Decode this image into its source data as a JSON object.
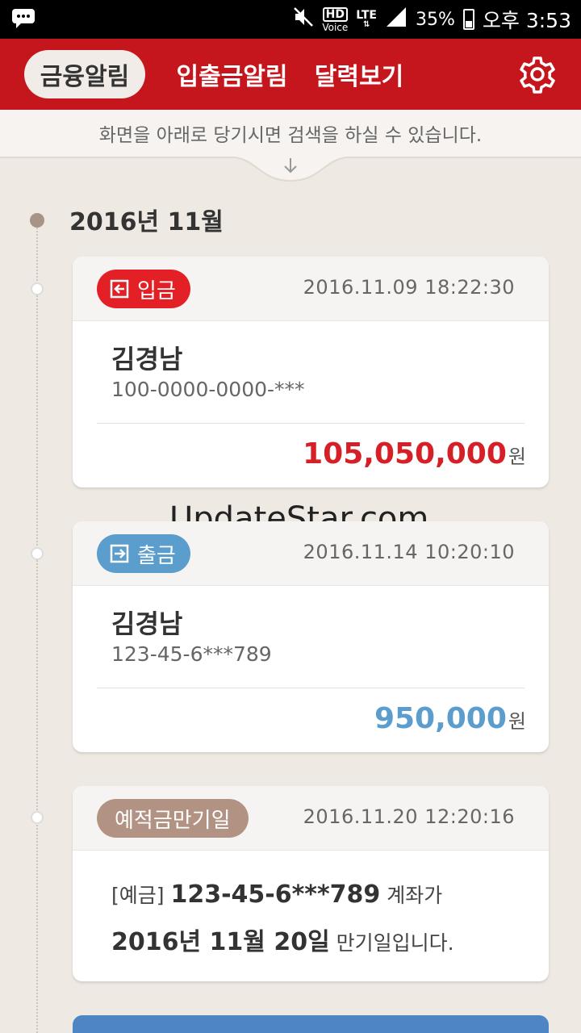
{
  "status_bar": {
    "hd": "HD",
    "voice": "Voice",
    "lte": "LTE",
    "battery": "35%",
    "time": "오후 3:53"
  },
  "header": {
    "tabs": [
      {
        "label": "금융알림",
        "active": true
      },
      {
        "label": "입출금알림",
        "active": false
      },
      {
        "label": "달력보기",
        "active": false
      }
    ]
  },
  "hint": "화면을 아래로 당기시면 검색을 하실 수 있습니다.",
  "month": "2016년 11월",
  "watermark": "UpdateStar.com",
  "cards": [
    {
      "badge": "입금",
      "datetime": "2016.11.09  18:22:30",
      "name": "김경남",
      "account": "100-0000-0000-***",
      "amount": "105,050,000",
      "currency": "원"
    },
    {
      "badge": "출금",
      "datetime": "2016.11.14  10:20:10",
      "name": "김경남",
      "account": "123-45-6***789",
      "amount": "950,000",
      "currency": "원"
    },
    {
      "badge": "예적금만기일",
      "datetime": "2016.11.20  12:20:16",
      "prefix": "[예금]",
      "account": "123-45-6***789",
      "suffix1": "계좌가",
      "date": "2016년 11월 20일",
      "suffix2": "만기일입니다."
    }
  ],
  "colors": {
    "header": "#c4161c",
    "deposit": "#e32026",
    "withdraw": "#5b9dcd",
    "maturity": "#b29383"
  }
}
